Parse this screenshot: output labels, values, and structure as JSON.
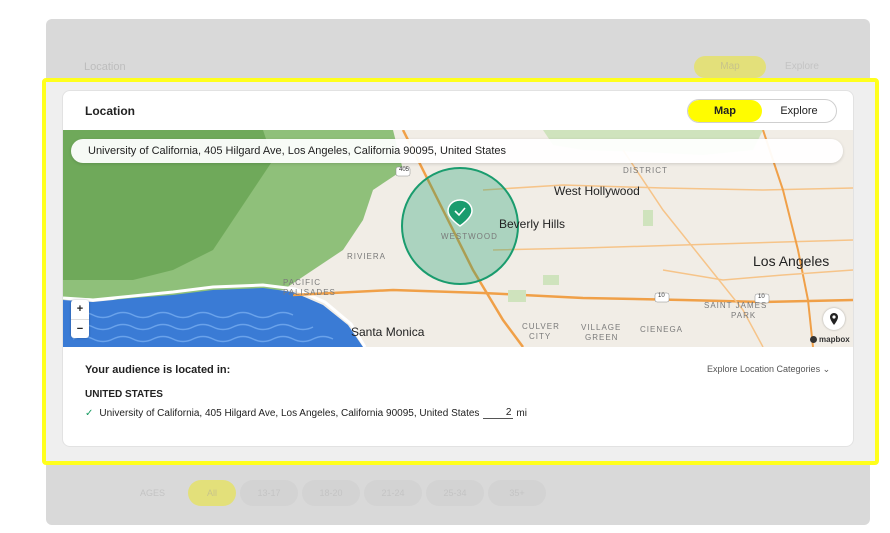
{
  "background": {
    "header_label": "Location",
    "toggle": [
      "Map",
      "Explore"
    ],
    "age_label": "AGES",
    "age_options": [
      "All",
      "13-17",
      "18-20",
      "21-24",
      "25-34",
      "35+"
    ]
  },
  "location_card": {
    "title": "Location",
    "view_toggle": {
      "map_label": "Map",
      "explore_label": "Explore",
      "selected": "Map"
    },
    "map": {
      "search_value": "University of California, 405 Hilgard Ave, Los Angeles, California 90095, United States",
      "labels": {
        "west_hollywood": "West Hollywood",
        "beverly_hills": "Beverly Hills",
        "los_angeles": "Los Angeles",
        "santa_monica": "Santa Monica",
        "westwood": "WESTWOOD",
        "riviera": "RIVIERA",
        "pacific_palisades_1": "PACIFIC",
        "pacific_palisades_2": "PALISADES",
        "district": "DISTRICT",
        "culver_1": "CULVER",
        "culver_2": "CITY",
        "village_1": "VILLAGE",
        "village_2": "GREEN",
        "cienega": "CIENEGA",
        "saint_james_1": "SAINT JAMES",
        "saint_james_2": "PARK",
        "hwy_405": "405",
        "hwy_10a": "10",
        "hwy_10b": "10"
      },
      "zoom_in": "+",
      "zoom_out": "−",
      "attribution": "mapbox",
      "radius_color": "#1a9c6e"
    },
    "audience": {
      "heading": "Your audience is located in:",
      "explore_categories": "Explore Location Categories",
      "country": "UNITED STATES",
      "locations": [
        {
          "name": "University of California, 405 Hilgard Ave, Los Angeles, California 90095, United States",
          "radius": "2",
          "unit": "mi"
        }
      ]
    }
  },
  "colors": {
    "accent": "#fffc00",
    "highlight": "#ffff1c",
    "check": "#1a9c63"
  }
}
